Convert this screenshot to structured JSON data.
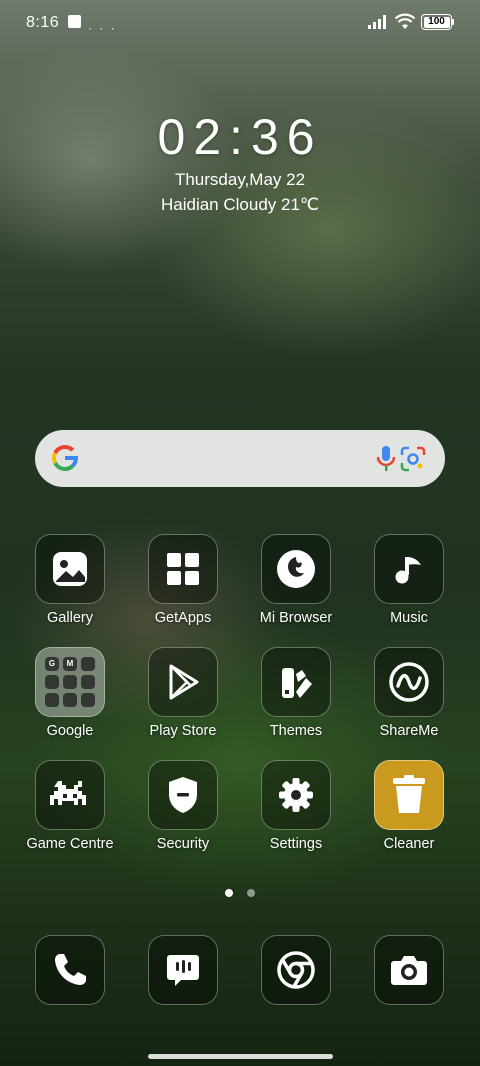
{
  "status_bar": {
    "time": "8:16",
    "battery": "100",
    "dots": "· · ·"
  },
  "clock_widget": {
    "time": "02:36",
    "date": "Thursday,May 22",
    "weather": "Haidian Cloudy 21℃"
  },
  "search": {
    "provider_icon": "google-g-icon",
    "mic_icon": "mic-icon",
    "lens_icon": "lens-icon"
  },
  "apps": [
    {
      "label": "Gallery",
      "icon": "gallery-icon"
    },
    {
      "label": "GetApps",
      "icon": "getapps-icon"
    },
    {
      "label": "Mi Browser",
      "icon": "browser-icon"
    },
    {
      "label": "Music",
      "icon": "music-icon"
    },
    {
      "label": "Google",
      "icon": "folder-icon"
    },
    {
      "label": "Play Store",
      "icon": "play-store-icon"
    },
    {
      "label": "Themes",
      "icon": "themes-icon"
    },
    {
      "label": "ShareMe",
      "icon": "shareme-icon"
    },
    {
      "label": "Game Centre",
      "icon": "game-icon"
    },
    {
      "label": "Security",
      "icon": "security-icon"
    },
    {
      "label": "Settings",
      "icon": "settings-icon"
    },
    {
      "label": "Cleaner",
      "icon": "trash-icon"
    }
  ],
  "folder_items": [
    "G",
    "M",
    "",
    "",
    "",
    "",
    "",
    "",
    ""
  ],
  "dock": [
    "phone-icon",
    "messages-icon",
    "chrome-icon",
    "camera-icon"
  ],
  "page_indicator": {
    "pages": 2,
    "current": 1
  },
  "colors": {
    "cleaner": "#c99a1e",
    "search_bar": "#eceeec"
  }
}
